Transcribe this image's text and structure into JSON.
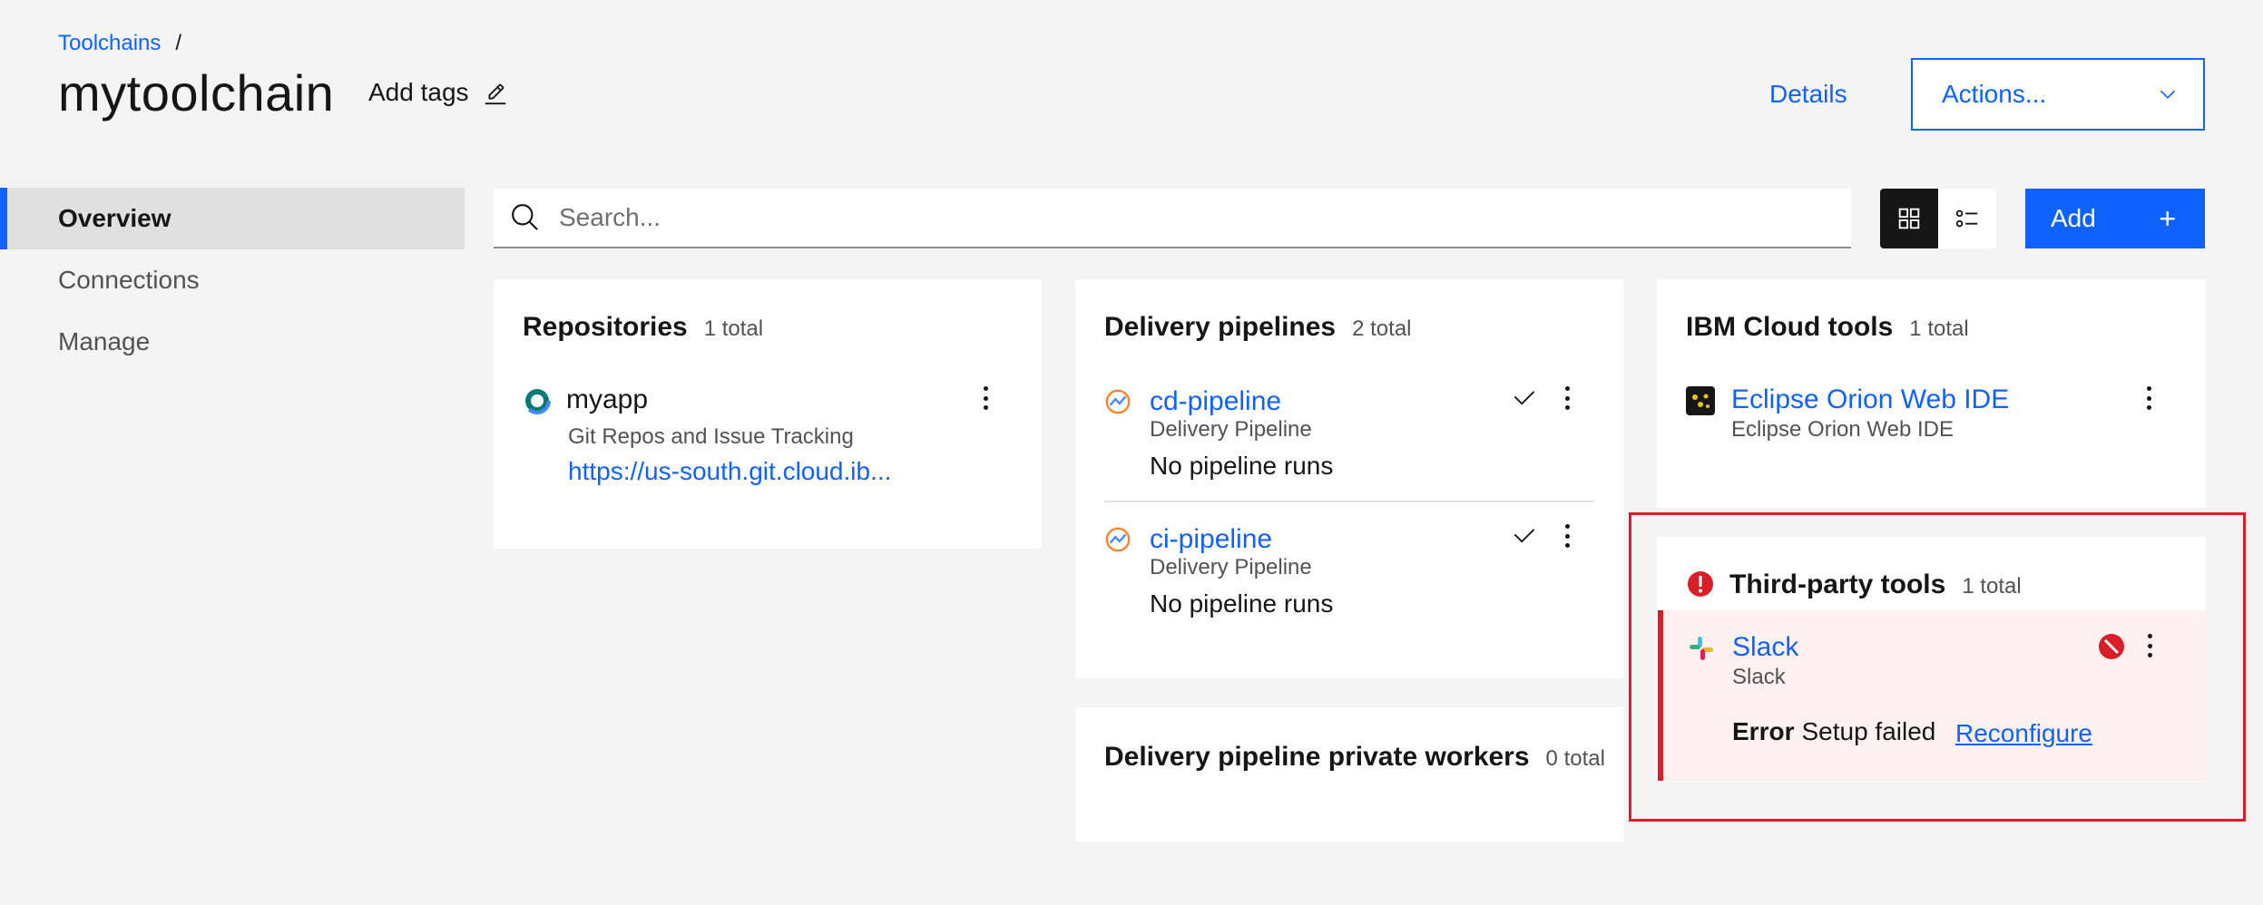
{
  "breadcrumb": {
    "items": [
      "Toolchains"
    ],
    "separator": "/"
  },
  "page": {
    "title": "mytoolchain",
    "add_tags_label": "Add tags"
  },
  "header": {
    "details_label": "Details",
    "actions_label": "Actions..."
  },
  "sidebar": {
    "items": [
      {
        "label": "Overview",
        "active": true
      },
      {
        "label": "Connections",
        "active": false
      },
      {
        "label": "Manage",
        "active": false
      }
    ]
  },
  "toolbar": {
    "search_placeholder": "Search...",
    "add_label": "Add",
    "add_icon": "+",
    "views": [
      "grid-view-icon",
      "list-view-icon"
    ]
  },
  "repositories": {
    "title": "Repositories",
    "count": "1 total",
    "items": [
      {
        "name": "myapp",
        "type": "Git Repos and Issue Tracking",
        "url": "https://us-south.git.cloud.ib..."
      }
    ]
  },
  "delivery_pipelines": {
    "title": "Delivery pipelines",
    "count": "2 total",
    "items": [
      {
        "name": "cd-pipeline",
        "type": "Delivery Pipeline",
        "status": "No pipeline runs"
      },
      {
        "name": "ci-pipeline",
        "type": "Delivery Pipeline",
        "status": "No pipeline runs"
      }
    ]
  },
  "private_workers": {
    "title": "Delivery pipeline private workers",
    "count": "0 total"
  },
  "ibm_cloud_tools": {
    "title": "IBM Cloud tools",
    "count": "1 total",
    "items": [
      {
        "name": "Eclipse Orion Web IDE",
        "type": "Eclipse Orion Web IDE"
      }
    ]
  },
  "third_party_tools": {
    "title": "Third-party tools",
    "count": "1 total",
    "items": [
      {
        "name": "Slack",
        "type": "Slack",
        "error_label": "Error",
        "error_message": "Setup failed",
        "action_label": "Reconfigure"
      }
    ]
  },
  "colors": {
    "primary": "#0f62fe",
    "error": "#da1e28",
    "error_bg": "#fff1f1",
    "background": "#f4f4f4"
  }
}
